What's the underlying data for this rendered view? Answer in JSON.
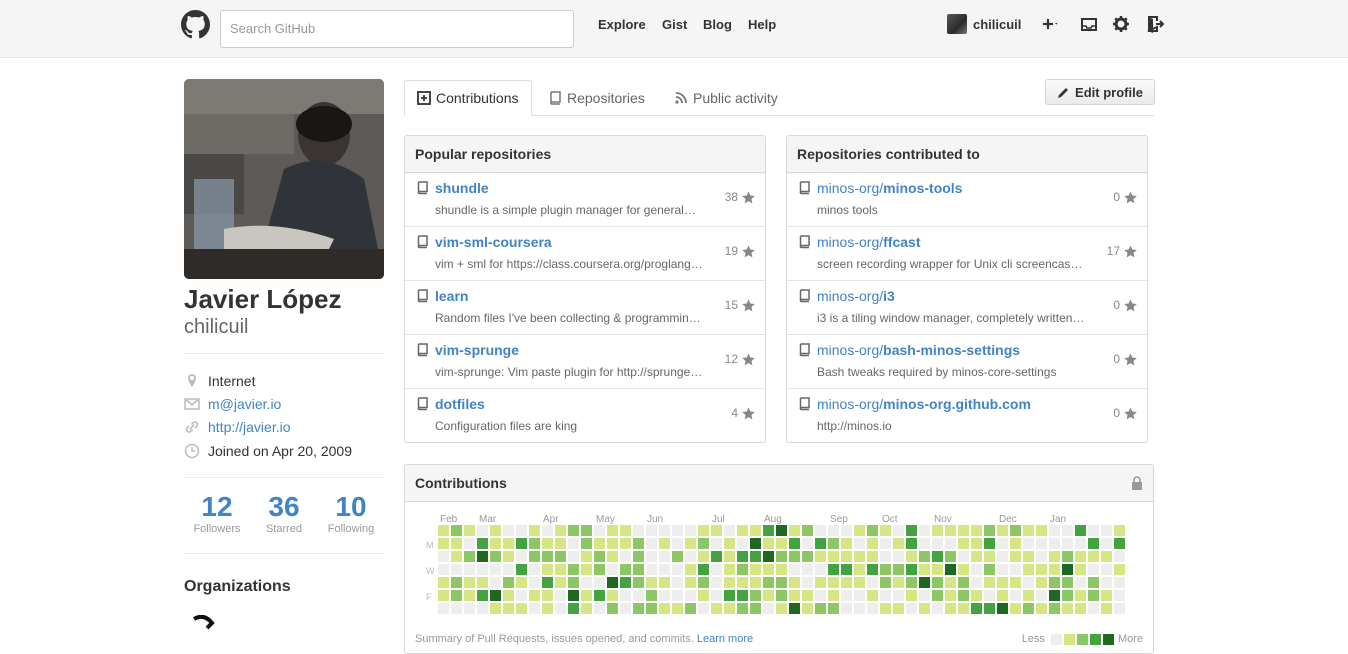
{
  "header": {
    "search_placeholder": "Search GitHub",
    "nav": [
      "Explore",
      "Gist",
      "Blog",
      "Help"
    ],
    "username": "chilicuil",
    "icons": [
      "github-logo-icon",
      "plus-icon",
      "inbox-icon",
      "gear-icon",
      "sign-out-icon"
    ]
  },
  "profile": {
    "fullname": "Javier López",
    "username": "chilicuil",
    "location": "Internet",
    "email": "m@javier.io",
    "website": "http://javier.io",
    "joined": "Joined on Apr 20, 2009",
    "stats": [
      {
        "value": "12",
        "label": "Followers"
      },
      {
        "value": "36",
        "label": "Starred"
      },
      {
        "value": "10",
        "label": "Following"
      }
    ],
    "organizations_title": "Organizations"
  },
  "tabs": [
    {
      "label": "Contributions",
      "icon": "plus-square-icon",
      "selected": true
    },
    {
      "label": "Repositories",
      "icon": "repo-icon",
      "selected": false
    },
    {
      "label": "Public activity",
      "icon": "rss-icon",
      "selected": false
    }
  ],
  "edit_profile_label": "Edit profile",
  "popular": {
    "title": "Popular repositories",
    "repos": [
      {
        "name": "shundle",
        "desc": "shundle is a simple plugin manager for general…",
        "stars": "38"
      },
      {
        "name": "vim-sml-coursera",
        "desc": "vim + sml for https://class.coursera.org/proglang…",
        "stars": "19"
      },
      {
        "name": "learn",
        "desc": "Random files I've been collecting & programming…",
        "stars": "15"
      },
      {
        "name": "vim-sprunge",
        "desc": "vim-sprunge: Vim paste plugin for http://sprunge.us…",
        "stars": "12"
      },
      {
        "name": "dotfiles",
        "desc": "Configuration files are king",
        "stars": "4"
      }
    ]
  },
  "contributed": {
    "title": "Repositories contributed to",
    "repos": [
      {
        "owner": "minos-org/",
        "name": "minos-tools",
        "desc": "minos tools",
        "stars": "0"
      },
      {
        "owner": "minos-org/",
        "name": "ffcast",
        "desc": "screen recording wrapper for Unix cli screencasting…",
        "stars": "17"
      },
      {
        "owner": "minos-org/",
        "name": "i3",
        "desc": "i3 is a tiling window manager, completely written…",
        "stars": "0"
      },
      {
        "owner": "minos-org/",
        "name": "bash-minos-settings",
        "desc": "Bash tweaks required by minos-core-settings",
        "stars": "0"
      },
      {
        "owner": "minos-org/",
        "name": "minos-org.github.com",
        "desc": "http://minos.io",
        "stars": "0"
      }
    ]
  },
  "contributions": {
    "title": "Contributions",
    "months": [
      "Feb",
      "Mar",
      "Apr",
      "May",
      "Jun",
      "Jul",
      "Aug",
      "Sep",
      "Oct",
      "Nov",
      "Dec",
      "Jan"
    ],
    "days": [
      "M",
      "W",
      "F"
    ],
    "footer": "Summary of Pull Requests, issues opened, and commits.",
    "learn_more": "Learn more",
    "less": "Less",
    "more": "More",
    "colors": [
      "#eeeeee",
      "#d6e685",
      "#8cc665",
      "#44a340",
      "#1e6823"
    ]
  }
}
